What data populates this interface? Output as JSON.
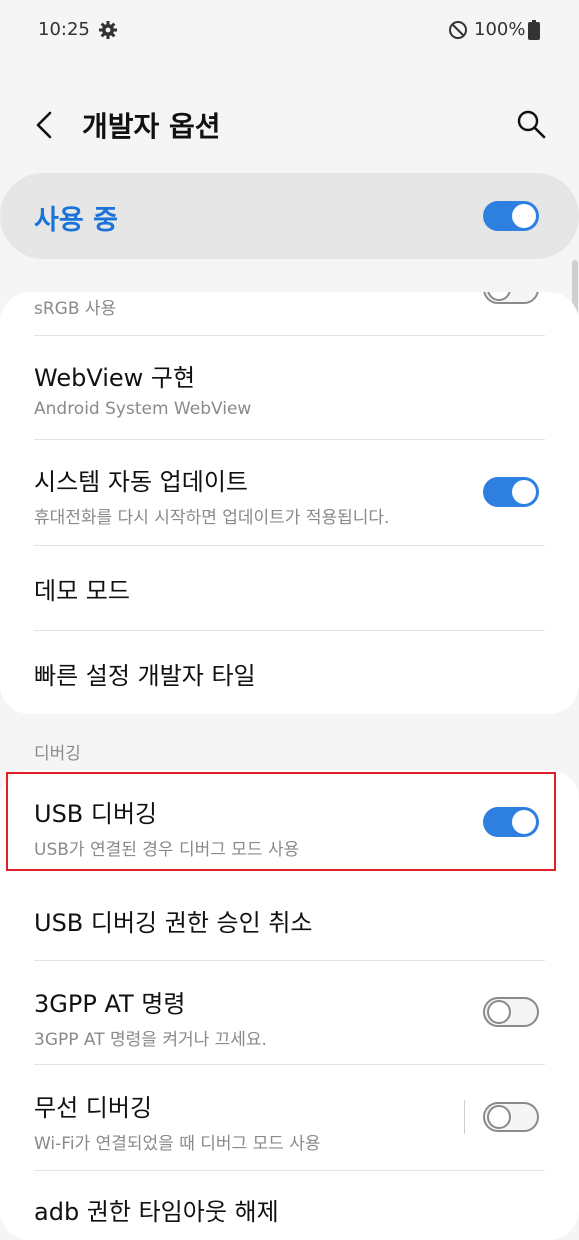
{
  "status": {
    "time": "10:25",
    "battery": "100%"
  },
  "header": {
    "title": "개발자 옵션"
  },
  "master": {
    "label": "사용 중",
    "on": true
  },
  "items": [
    {
      "title": "",
      "subtitle": "sRGB 사용",
      "toggle": "off"
    },
    {
      "title": "WebView 구현",
      "subtitle": "Android System WebView"
    },
    {
      "title": "시스템 자동 업데이트",
      "subtitle": "휴대전화를 다시 시작하면 업데이트가 적용됩니다.",
      "toggle": "on"
    },
    {
      "title": "데모 모드"
    },
    {
      "title": "빠른 설정 개발자 타일"
    }
  ],
  "debug_section": {
    "label": "디버깅"
  },
  "debug_items": [
    {
      "title": "USB 디버깅",
      "subtitle": "USB가 연결된 경우 디버그 모드 사용",
      "toggle": "on"
    },
    {
      "title": "USB 디버깅 권한 승인 취소"
    },
    {
      "title": "3GPP AT 명령",
      "subtitle": "3GPP AT 명령을 켜거나 끄세요.",
      "toggle": "off"
    },
    {
      "title": "무선 디버깅",
      "subtitle": "Wi-Fi가 연결되었을 때 디버그 모드 사용",
      "toggle": "off"
    },
    {
      "title": "adb 권한 타임아웃 해제"
    }
  ],
  "colors": {
    "accent": "#2d7fe0",
    "master_text": "#1a73d9",
    "highlight": "#e01f26"
  }
}
